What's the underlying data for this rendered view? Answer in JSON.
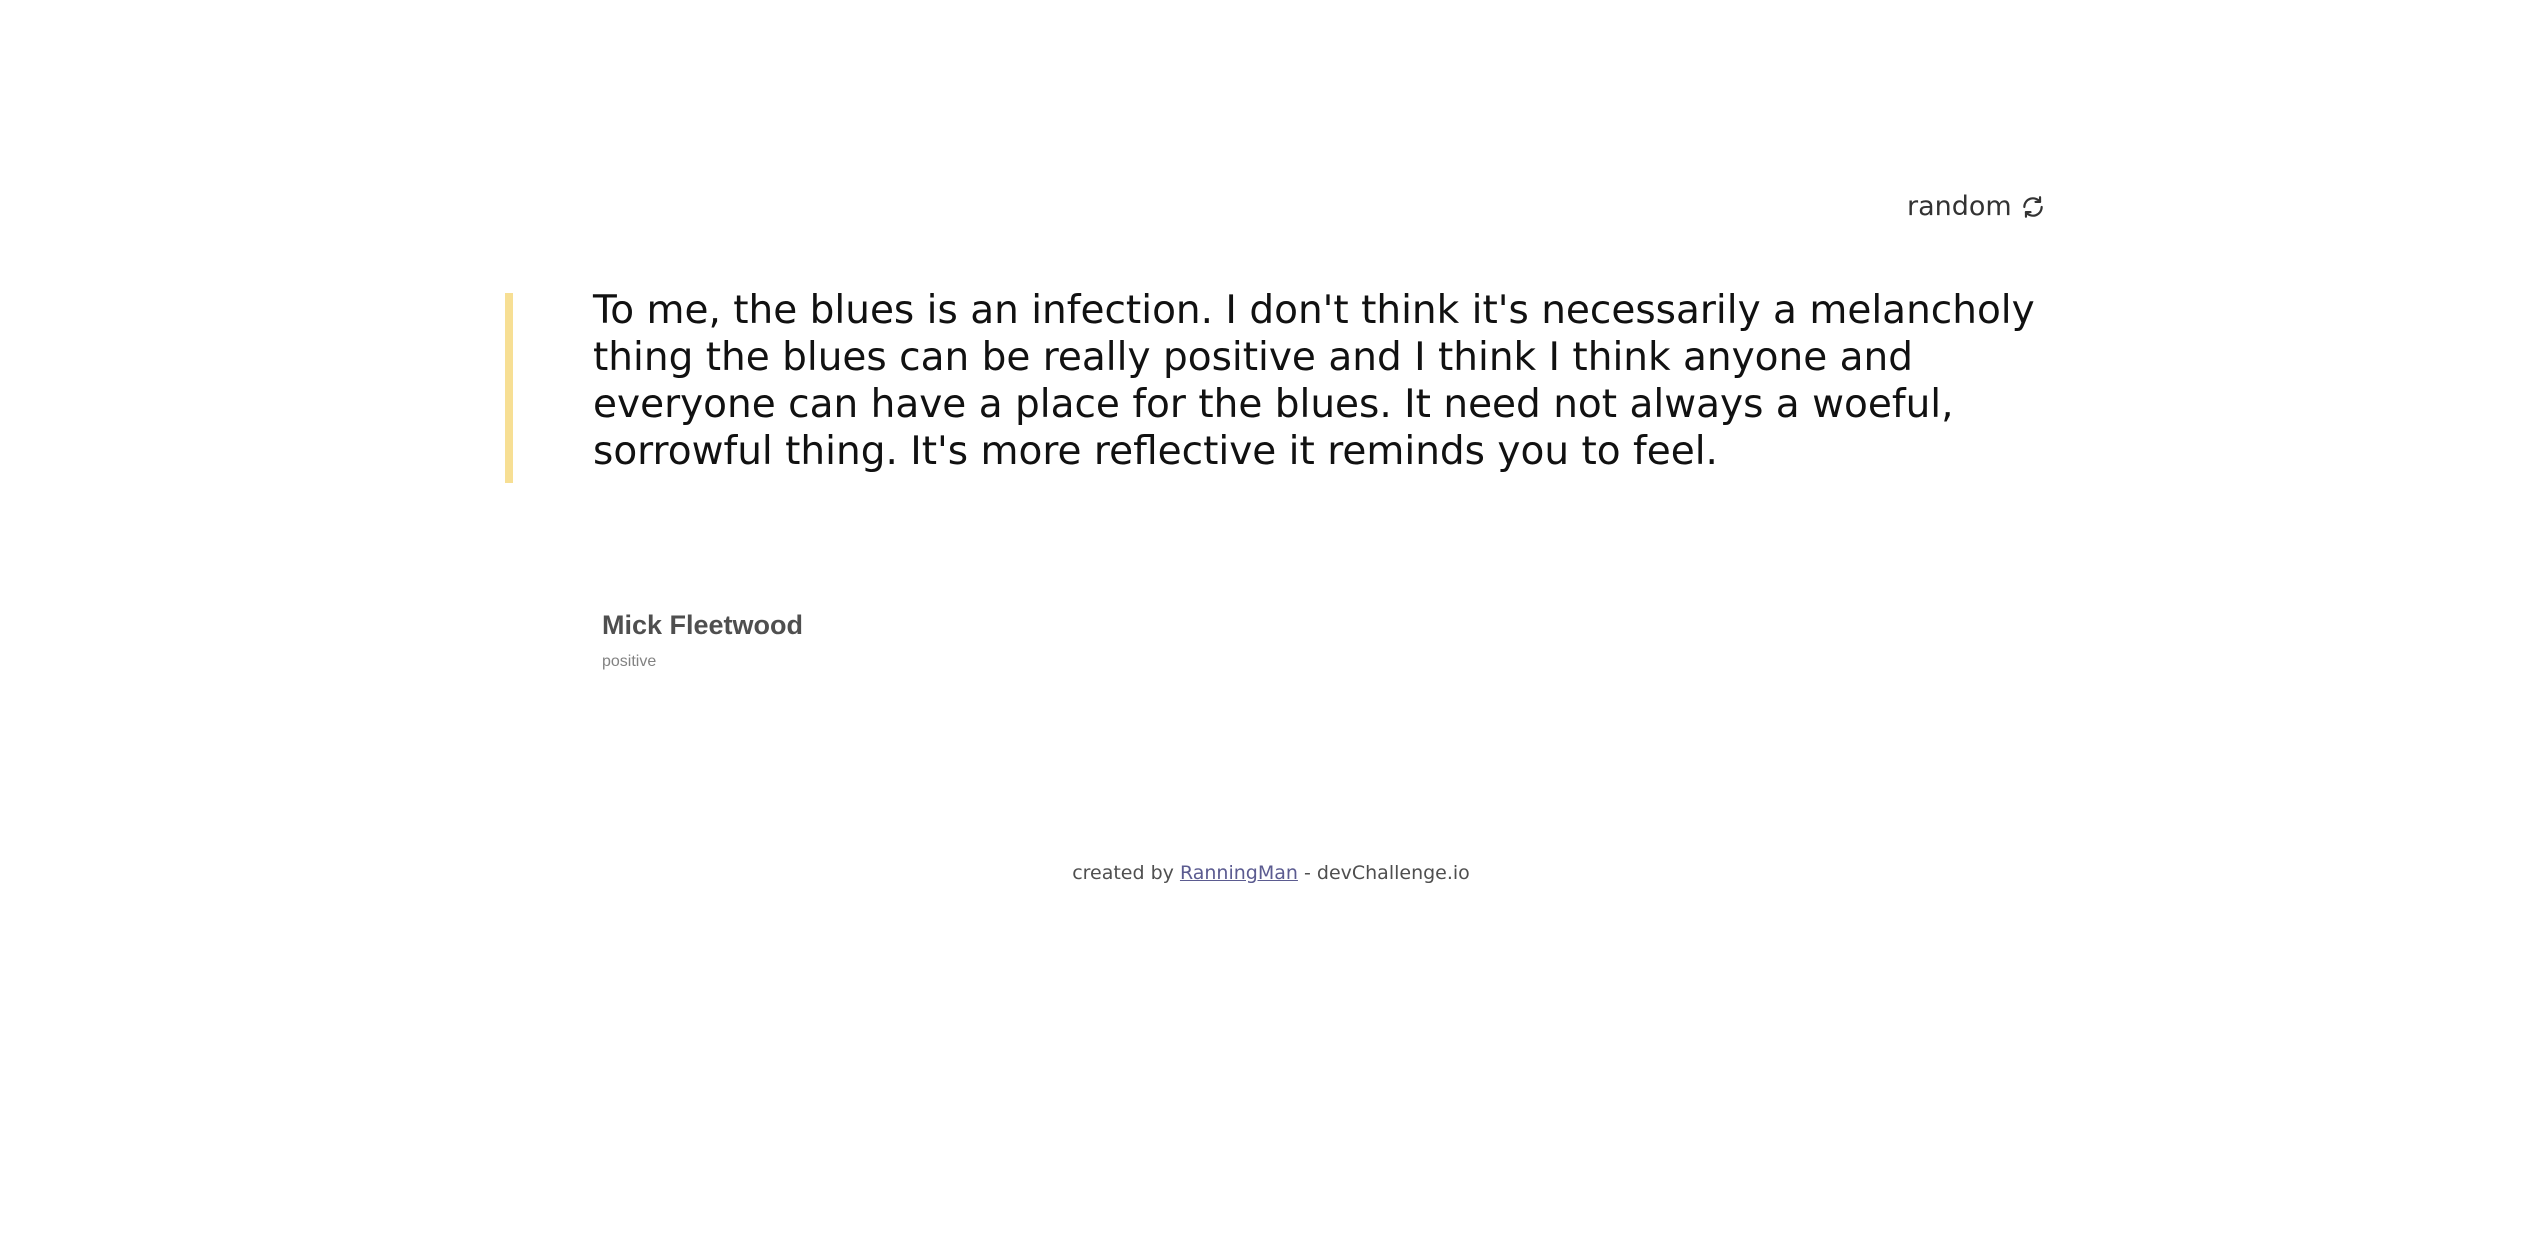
{
  "header": {
    "random_label": "random",
    "random_icon": "refresh-icon"
  },
  "quote": {
    "text": "To me, the blues is an infection. I don't think it's necessarily a melancholy thing the blues can be really positive and I think I think anyone and everyone can have a place for the blues. It need not always a woeful, sorrowful thing. It's more reflective it reminds you to feel.",
    "accent_color": "#f7df94"
  },
  "author": {
    "name": "Mick Fleetwood",
    "genre": "positive"
  },
  "footer": {
    "prefix": "created by",
    "link_text": "RanningMan",
    "suffix": "- devChallenge.io"
  }
}
